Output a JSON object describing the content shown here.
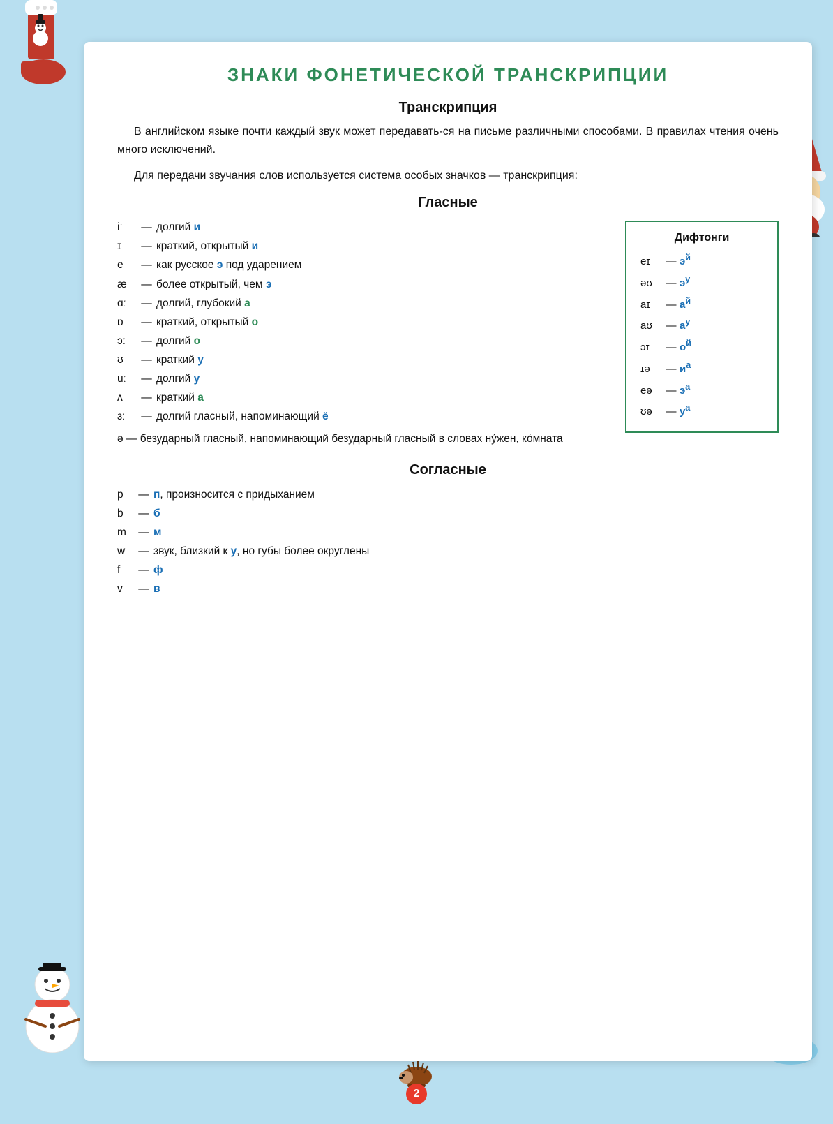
{
  "page": {
    "background_color": "#b8dff0",
    "title": "ЗНАКИ ФОНЕТИЧЕСКОЙ ТРАНСКРИПЦИИ",
    "title_color": "#2e8b57",
    "section_transcription": {
      "heading": "Транскрипция",
      "paragraph1": "В английском языке почти каждый звук может передавать-ся на письме различными способами. В правилах чтения очень много исключений.",
      "paragraph2": "Для передачи звучания слов используется система особых значков — транскрипция:"
    },
    "section_vowels": {
      "heading": "Гласные",
      "rows": [
        {
          "symbol": "iː",
          "dash": "—",
          "desc": "долгий ",
          "highlight": "и",
          "hl_color": "blue"
        },
        {
          "symbol": "ɪ",
          "dash": "—",
          "desc": "краткий, открытый ",
          "highlight": "и",
          "hl_color": "blue"
        },
        {
          "symbol": "e",
          "dash": "—",
          "desc": "как русское ",
          "highlight": "э",
          "hl_color": "blue",
          "rest": " под ударением"
        },
        {
          "symbol": "æ",
          "dash": "—",
          "desc": "более открытый, чем ",
          "highlight": "э",
          "hl_color": "blue"
        },
        {
          "symbol": "ɑː",
          "dash": "—",
          "desc": "долгий, глубокий ",
          "highlight": "а",
          "hl_color": "green"
        },
        {
          "symbol": "ɒ",
          "dash": "—",
          "desc": "краткий, открытый ",
          "highlight": "о",
          "hl_color": "green"
        },
        {
          "symbol": "ɔː",
          "dash": "—",
          "desc": "долгий ",
          "highlight": "о",
          "hl_color": "green"
        },
        {
          "symbol": "ʊ",
          "dash": "—",
          "desc": "краткий ",
          "highlight": "у",
          "hl_color": "blue"
        },
        {
          "symbol": "uː",
          "dash": "—",
          "desc": "долгий ",
          "highlight": "у",
          "hl_color": "blue"
        },
        {
          "symbol": "ʌ",
          "dash": "—",
          "desc": "краткий ",
          "highlight": "а",
          "hl_color": "green"
        },
        {
          "symbol": "ɜː",
          "dash": "—",
          "desc": "долгий гласный, напоминающий ",
          "highlight": "ё",
          "hl_color": "blue"
        }
      ],
      "schwa_row": {
        "symbol": "ə",
        "dash": "—",
        "desc": "безударный гласный, напоминающий безударный глас-ный в словах ну́жен, ко́мната"
      }
    },
    "section_diphthongs": {
      "heading": "Дифтонги",
      "rows": [
        {
          "symbol": "eɪ",
          "dash": "—",
          "value": "эй"
        },
        {
          "symbol": "əʊ",
          "dash": "—",
          "value": "эу"
        },
        {
          "symbol": "aɪ",
          "dash": "—",
          "value": "ай"
        },
        {
          "symbol": "aʊ",
          "dash": "—",
          "value": "ау"
        },
        {
          "symbol": "ɔɪ",
          "dash": "—",
          "value": "ой"
        },
        {
          "symbol": "ɪə",
          "dash": "—",
          "value": "иа"
        },
        {
          "symbol": "eə",
          "dash": "—",
          "value": "эа"
        },
        {
          "symbol": "ʊə",
          "dash": "—",
          "value": "уа"
        }
      ]
    },
    "section_consonants": {
      "heading": "Согласные",
      "rows": [
        {
          "symbol": "p",
          "dash": "—",
          "highlight": "п",
          "hl_color": "blue",
          "rest": ", произносится с придыханием"
        },
        {
          "symbol": "b",
          "dash": "—",
          "highlight": "б",
          "hl_color": "blue",
          "rest": ""
        },
        {
          "symbol": "m",
          "dash": "—",
          "highlight": "м",
          "hl_color": "blue",
          "rest": ""
        },
        {
          "symbol": "w",
          "dash": "—",
          "rest_before": "звук, близкий к ",
          "highlight": "у",
          "hl_color": "blue",
          "rest": ", но губы более округлены"
        },
        {
          "symbol": "f",
          "dash": "—",
          "highlight": "ф",
          "hl_color": "blue",
          "rest": ""
        },
        {
          "symbol": "v",
          "dash": "—",
          "highlight": "в",
          "hl_color": "blue",
          "rest": ""
        }
      ]
    },
    "page_number": "2"
  }
}
